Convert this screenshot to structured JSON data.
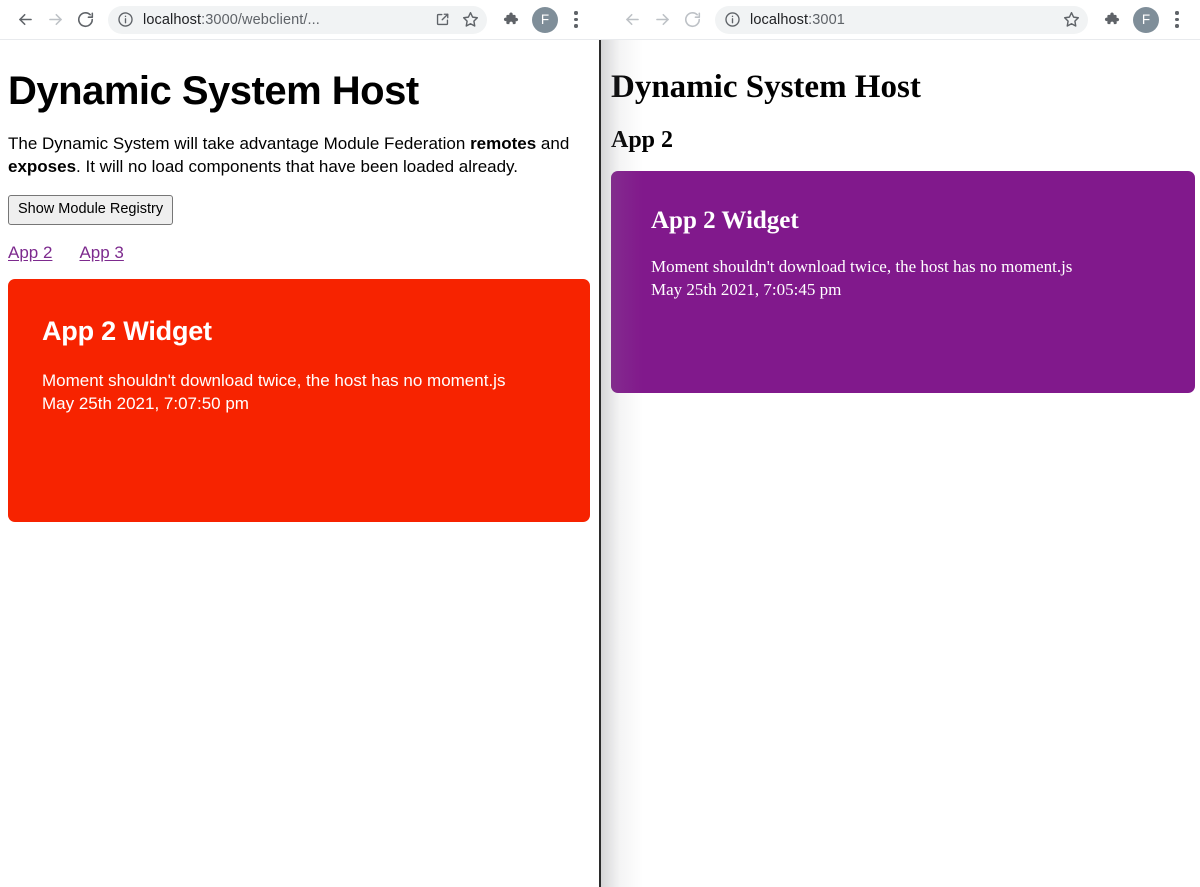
{
  "windows": {
    "left": {
      "toolbar": {
        "back_label": "Back",
        "forward_label": "Forward",
        "reload_label": "Reload",
        "info_label": "View site information",
        "url_host": "localhost",
        "url_rest": ":3000/webclient/...",
        "url_full": "localhost:3000/webclient/...",
        "share_label": "Share this page",
        "bookmark_label": "Bookmark this tab",
        "extensions_label": "Extensions",
        "avatar_initial": "F",
        "menu_label": "Customize and control Google Chrome"
      },
      "page": {
        "title": "Dynamic System Host",
        "intro_part1": "The Dynamic System will take advantage Module Federation ",
        "intro_bold1": "remotes",
        "intro_part2": " and ",
        "intro_bold2": "exposes",
        "intro_part3": ". It will no load components that have been loaded already.",
        "registry_button": "Show Module Registry",
        "links": [
          {
            "label": "App 2"
          },
          {
            "label": "App 3"
          }
        ],
        "widget": {
          "heading": "App 2 Widget",
          "body": "Moment shouldn't download twice, the host has no moment.js\nMay 25th 2021, 7:07:50 pm",
          "background_color": "#f72300",
          "text_color": "#ffffff"
        }
      }
    },
    "right": {
      "toolbar": {
        "back_label": "Back",
        "forward_label": "Forward",
        "reload_label": "Reload",
        "info_label": "View site information",
        "url_host": "localhost",
        "url_rest": ":3001",
        "url_full": "localhost:3001",
        "bookmark_label": "Bookmark this tab",
        "extensions_label": "Extensions",
        "avatar_initial": "F",
        "menu_label": "Customize and control Google Chrome"
      },
      "page": {
        "title": "Dynamic System Host",
        "section_heading": "App 2",
        "widget": {
          "heading": "App 2 Widget",
          "body": "Moment shouldn't download twice, the host has no moment.js\nMay 25th 2021, 7:05:45 pm",
          "background_color": "#81198c",
          "text_color": "#ffffff"
        }
      }
    }
  },
  "colors": {
    "link_purple": "#7d2a8e",
    "avatar_grey": "#7f8e99",
    "omnibox_grey": "#f1f3f4",
    "red_card": "#f72300",
    "purple_card": "#81198c"
  }
}
